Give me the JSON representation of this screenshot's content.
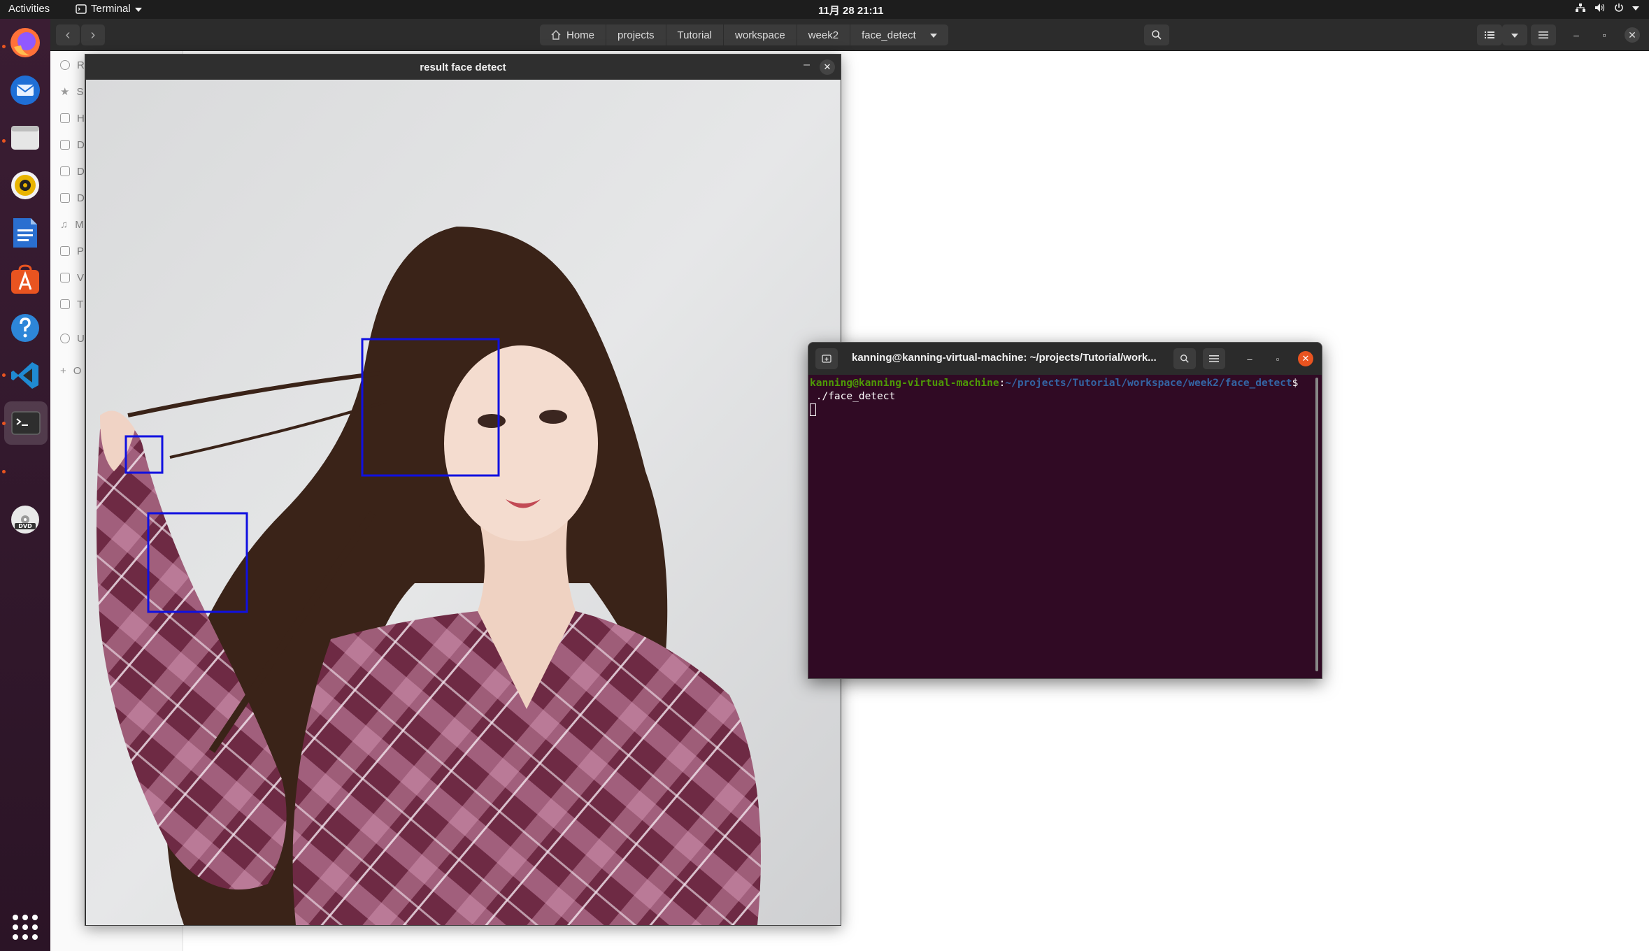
{
  "topbar": {
    "activities": "Activities",
    "app_name": "Terminal",
    "clock": "11月 28  21:11"
  },
  "files": {
    "breadcrumbs": [
      "Home",
      "projects",
      "Tutorial",
      "workspace",
      "week2",
      "face_detect"
    ],
    "sidebar_initials": [
      "R",
      "S",
      "H",
      "D",
      "D",
      "D",
      "M",
      "P",
      "V",
      "T",
      "U",
      "O"
    ]
  },
  "result_window": {
    "title": "result face detect",
    "accent_box_color": "#1010e0"
  },
  "terminal": {
    "title": "kanning@kanning-virtual-machine: ~/projects/Tutorial/work...",
    "prompt_user": "kanning@kanning-virtual-machine",
    "prompt_sep": ":",
    "prompt_path": "~/projects/Tutorial/workspace/week2/face_detect",
    "prompt_end": "$",
    "command": "./face_detect"
  }
}
